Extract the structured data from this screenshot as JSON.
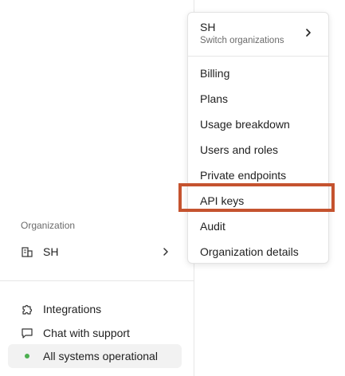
{
  "sidebar": {
    "organization_label": "Organization",
    "org_name": "SH",
    "nav": [
      {
        "label": "Integrations",
        "icon": "puzzle-icon"
      },
      {
        "label": "Chat with support",
        "icon": "chat-bubble-icon"
      },
      {
        "label": "All systems operational",
        "icon": "status-dot-icon"
      }
    ]
  },
  "menu": {
    "header_title": "SH",
    "header_subtitle": "Switch organizations",
    "items": [
      {
        "label": "Billing"
      },
      {
        "label": "Plans"
      },
      {
        "label": "Usage breakdown"
      },
      {
        "label": "Users and roles"
      },
      {
        "label": "Private endpoints"
      },
      {
        "label": "API keys"
      },
      {
        "label": "Audit"
      },
      {
        "label": "Organization details"
      }
    ],
    "highlighted_item": "API keys"
  },
  "colors": {
    "highlight_border": "#c5532f",
    "status_green": "#4caf50",
    "divider": "#e6e6e6",
    "status_bg": "#f2f2f2"
  }
}
